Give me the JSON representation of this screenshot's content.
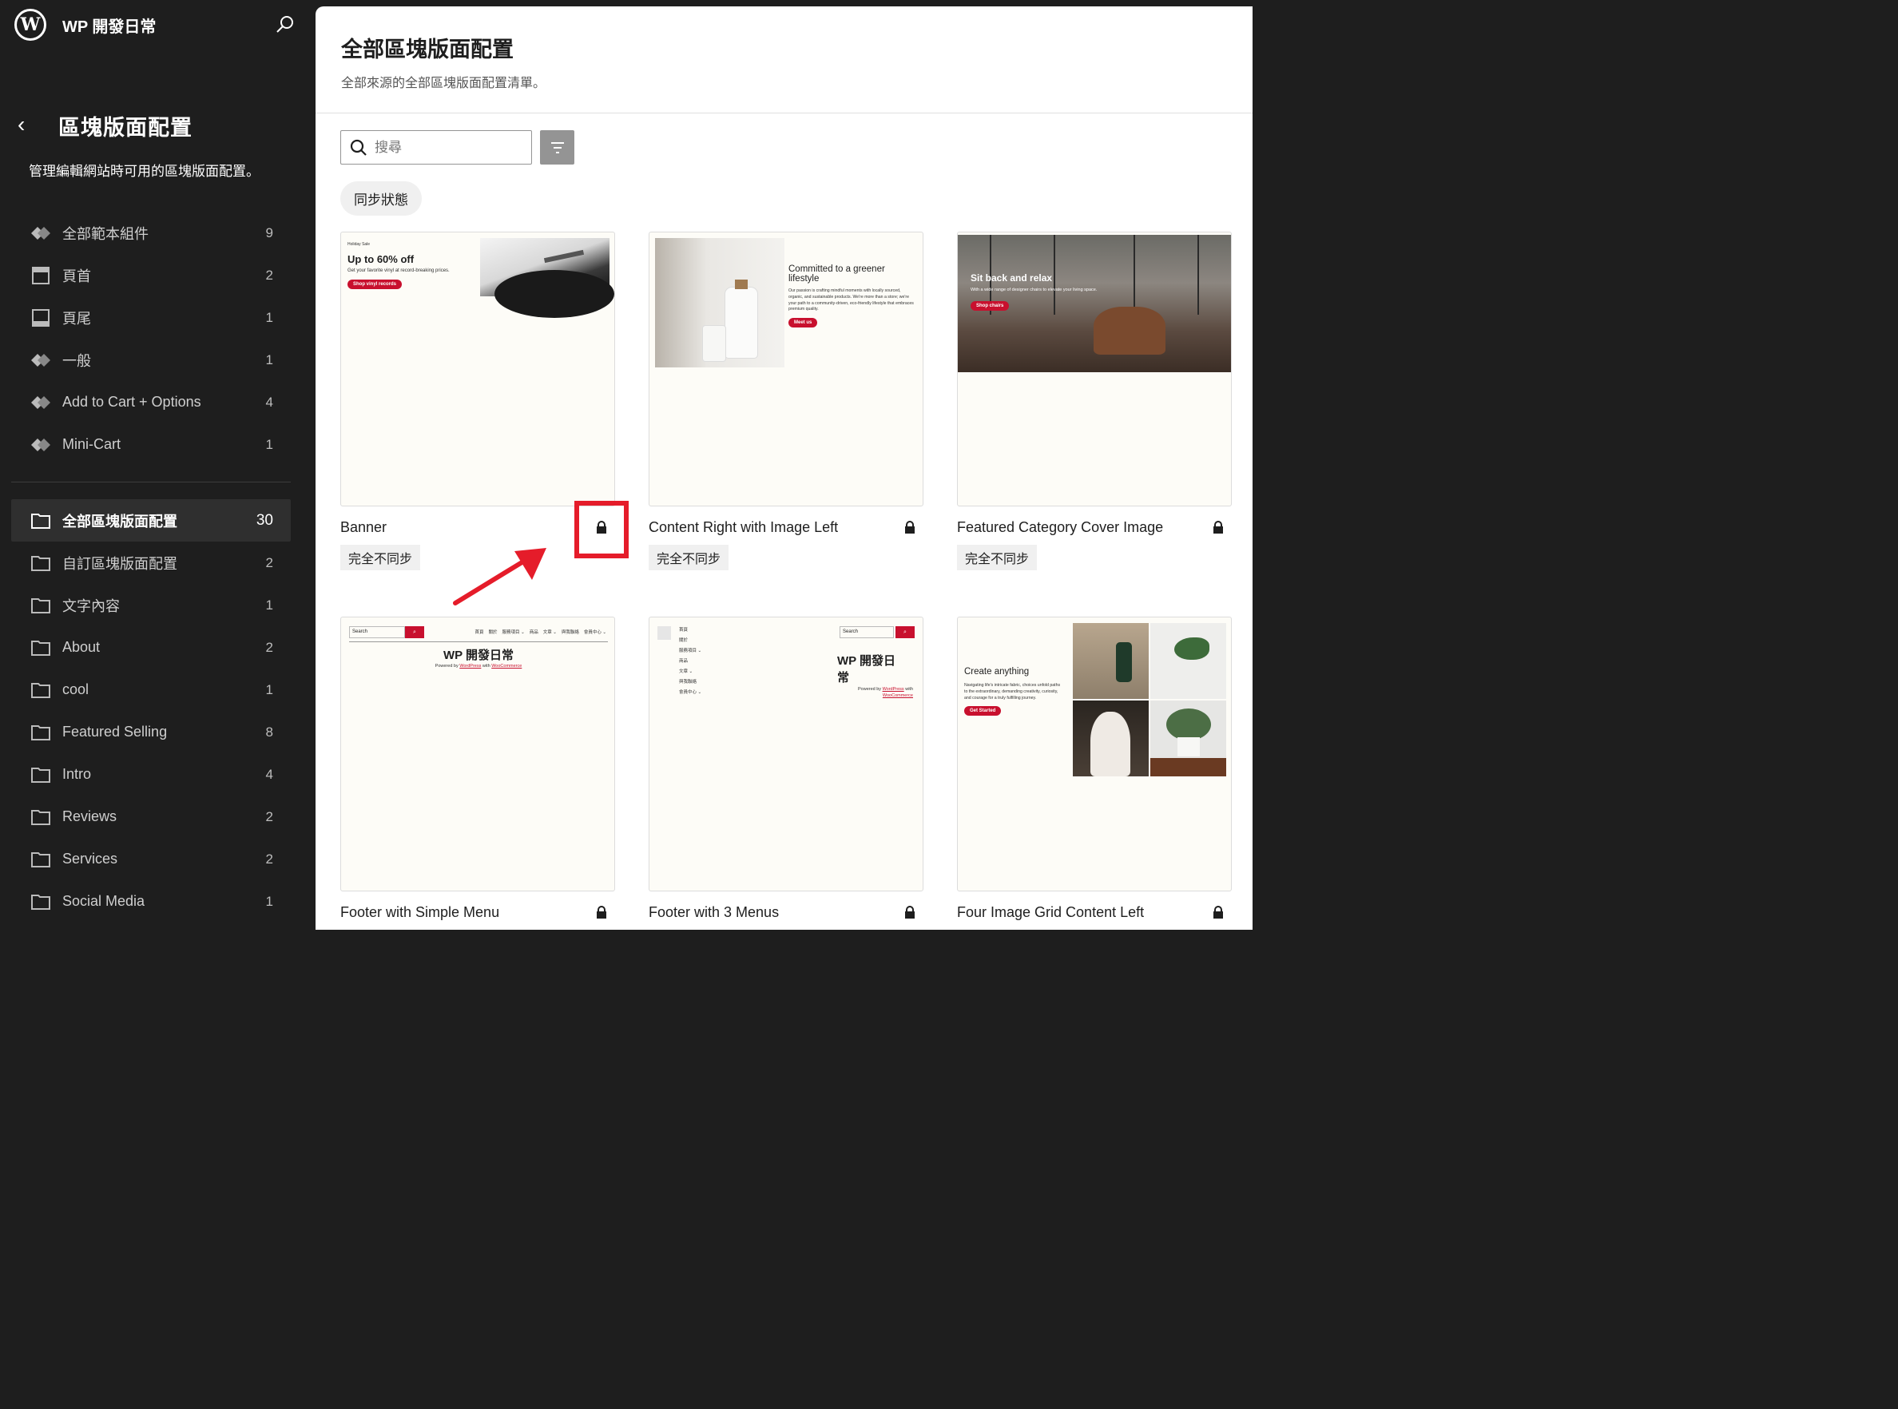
{
  "site": {
    "name": "WP 開發日常"
  },
  "sidebar": {
    "title": "區塊版面配置",
    "description": "管理編輯網站時可用的區塊版面配置。",
    "items": [
      {
        "label": "全部範本組件",
        "count": "9",
        "icon": "diamond-icon"
      },
      {
        "label": "頁首",
        "count": "2",
        "icon": "header-icon"
      },
      {
        "label": "頁尾",
        "count": "1",
        "icon": "footer-icon"
      },
      {
        "label": "一般",
        "count": "1",
        "icon": "diamond-icon"
      },
      {
        "label": "Add to Cart + Options",
        "count": "4",
        "icon": "diamond-icon"
      },
      {
        "label": "Mini-Cart",
        "count": "1",
        "icon": "diamond-icon"
      }
    ],
    "categories": [
      {
        "label": "全部區塊版面配置",
        "count": "30",
        "icon": "folder-icon"
      },
      {
        "label": "自訂區塊版面配置",
        "count": "2",
        "icon": "folder-icon"
      },
      {
        "label": "文字內容",
        "count": "1",
        "icon": "folder-icon"
      },
      {
        "label": "About",
        "count": "2",
        "icon": "folder-icon"
      },
      {
        "label": "cool",
        "count": "1",
        "icon": "folder-icon"
      },
      {
        "label": "Featured Selling",
        "count": "8",
        "icon": "folder-icon"
      },
      {
        "label": "Intro",
        "count": "4",
        "icon": "folder-icon"
      },
      {
        "label": "Reviews",
        "count": "2",
        "icon": "folder-icon"
      },
      {
        "label": "Services",
        "count": "2",
        "icon": "folder-icon"
      },
      {
        "label": "Social Media",
        "count": "1",
        "icon": "folder-icon"
      }
    ]
  },
  "main": {
    "title": "全部區塊版面配置",
    "description": "全部來源的全部區塊版面配置清單。",
    "search_placeholder": "搜尋",
    "sync_chip": "同步狀態",
    "patterns": [
      {
        "title": "Banner",
        "tag": "完全不同步",
        "preview": {
          "kicker": "Holiday Sale",
          "heading": "Up to 60% off",
          "body": "Get your favorite vinyl at record-breaking prices.",
          "button": "Shop vinyl records"
        }
      },
      {
        "title": "Content Right with Image Left",
        "tag": "完全不同步",
        "preview": {
          "heading": "Committed to a greener lifestyle",
          "body": "Our passion is crafting mindful moments with locally sourced, organic, and sustainable products. We're more than a store; we're your path to a community-driven, eco-friendly lifestyle that embraces premium quality.",
          "button": "Meet us"
        }
      },
      {
        "title": "Featured Category Cover Image",
        "tag": "完全不同步",
        "preview": {
          "heading": "Sit back and relax",
          "body": "With a wide range of designer chairs to elevate your living space.",
          "button": "Shop chairs"
        }
      },
      {
        "title": "Footer with Simple Menu",
        "preview": {
          "search": "Search",
          "menu": [
            "首頁",
            "關於",
            "服務項目 ⌄",
            "商品",
            "文章 ⌄",
            "與我聯絡",
            "會員中心 ⌄"
          ],
          "site": "WP 開發日常",
          "powered_prefix": "Powered by",
          "powered_wp": "WordPress",
          "powered_mid": "with",
          "powered_wc": "WooCommerce"
        }
      },
      {
        "title": "Footer with 3 Menus",
        "preview": {
          "search": "Search",
          "menu": [
            "首頁",
            "關於",
            "服務項目 ⌄",
            "商品",
            "文章 ⌄",
            "與我聯絡",
            "會員中心 ⌄"
          ],
          "site_line1": "WP 開發日",
          "site_line2": "常",
          "powered_prefix": "Powered by",
          "powered_wp": "WordPress",
          "powered_mid": "with",
          "powered_wc": "WooCommerce"
        }
      },
      {
        "title": "Four Image Grid Content Left",
        "preview": {
          "heading": "Create anything",
          "body": "Navigating life's intricate fabric, choices unfold paths to the extraordinary, demanding creativity, curiosity, and courage for a truly fulfilling journey.",
          "button": "Get Started"
        }
      }
    ]
  },
  "colors": {
    "sidebar_bg": "#1e1e1e",
    "accent_red": "#c8102e",
    "annotation_red": "#e51c2a",
    "thumb_bg": "#fdfcf7"
  }
}
